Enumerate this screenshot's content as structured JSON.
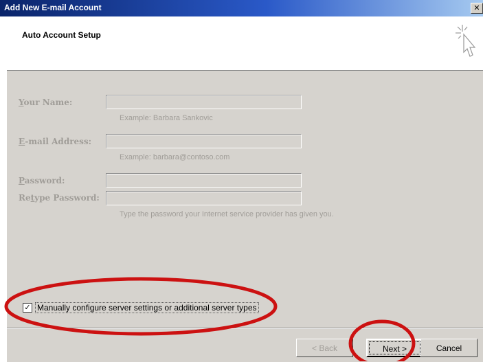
{
  "window": {
    "title": "Add New E-mail Account",
    "close_glyph": "✕"
  },
  "header": {
    "title": "Auto Account Setup",
    "icon": "cursor-sparkle-icon"
  },
  "form": {
    "your_name": {
      "label": "Your Name:",
      "hotkey": "Y",
      "value": "",
      "hint": "Example: Barbara Sankovic"
    },
    "email": {
      "label": "E-mail Address:",
      "hotkey": "E",
      "value": "",
      "hint": "Example: barbara@contoso.com"
    },
    "password": {
      "label": "Password:",
      "hotkey": "P",
      "value": ""
    },
    "retype_password": {
      "label": "Retype Password:",
      "hotkey": "t",
      "value": "",
      "hint": "Type the password your Internet service provider has given you."
    }
  },
  "manual_config": {
    "checked": true,
    "check_glyph": "✓",
    "label": "Manually configure server settings or additional server types"
  },
  "buttons": {
    "back": "< Back",
    "next": "Next >",
    "cancel": "Cancel"
  },
  "colors": {
    "titlebar": "#0a246a",
    "dialog_bg": "#d6d3ce",
    "disabled_text": "#a09d98",
    "annotation_red": "#cc1111"
  }
}
